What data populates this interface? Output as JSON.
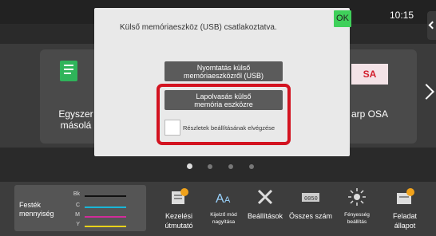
{
  "status": {
    "time": "10:15"
  },
  "home": {
    "card_left_label": "Egyszer\nmásolá",
    "card_right_label": "arp OSA",
    "card_right_logo": "SA"
  },
  "dialog": {
    "message": "Külső memóriaeszköz (USB) csatlakoztatva.",
    "ok": "OK",
    "print_button": "Nyomtatás külső\nmemóriaeszközről (USB)",
    "scan_button": "Lapolvasás külső\nmemória eszközre",
    "detail_checkbox_label": "Részletek beállításának elvégzése",
    "detail_checkbox_checked": false
  },
  "toner": {
    "label": "Festék\nmennyiség",
    "channels": [
      {
        "name": "Bk",
        "color": "#111111"
      },
      {
        "name": "C",
        "color": "#19b6d8"
      },
      {
        "name": "M",
        "color": "#d12c9b"
      },
      {
        "name": "Y",
        "color": "#e8d21a"
      }
    ]
  },
  "tools": [
    {
      "label": "Kezelési\nútmutató",
      "icon": "manual-icon"
    },
    {
      "label": "Kijelző mód\nnagyítása",
      "icon": "text-size-icon"
    },
    {
      "label": "Beállítások",
      "icon": "settings-tools-icon"
    },
    {
      "label": "Összes szám",
      "icon": "counter-icon"
    },
    {
      "label": "Fényesség\nbeállítás",
      "icon": "brightness-icon"
    },
    {
      "label": "Feladat\nállapot",
      "icon": "job-status-icon"
    }
  ],
  "colors": {
    "accent_ok": "#3fd05a",
    "highlight": "#d31320",
    "icon_orange": "#f0a21b"
  }
}
